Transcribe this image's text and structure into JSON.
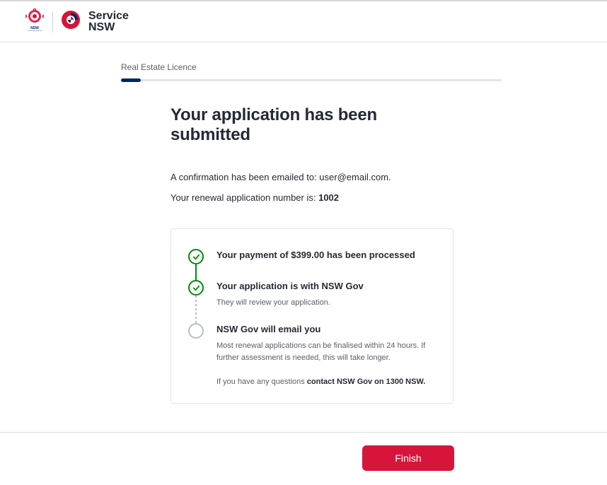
{
  "header": {
    "logo_alt": "NSW Government",
    "service_line1": "Service",
    "service_line2": "NSW"
  },
  "progress": {
    "label": "Real Estate Licence"
  },
  "page": {
    "title": "Your application has been submitted",
    "confirmation_prefix": "A confirmation has been emailed to: ",
    "confirmation_email": "user@email.com.",
    "renewal_prefix": "Your renewal application number is: ",
    "renewal_number": "1002"
  },
  "steps": [
    {
      "title": "Your payment of $399.00 has been processed",
      "desc": ""
    },
    {
      "title": "Your application is with NSW Gov",
      "desc": "They will review your application."
    },
    {
      "title": "NSW Gov will email you",
      "desc": "Most renewal applications can be finalised within 24 hours. If further assessment is needed, this will take longer."
    }
  ],
  "contact": {
    "prefix": "If you have any questions ",
    "bold": "contact NSW Gov on 1300 NSW."
  },
  "footer": {
    "finish": "Finish"
  }
}
